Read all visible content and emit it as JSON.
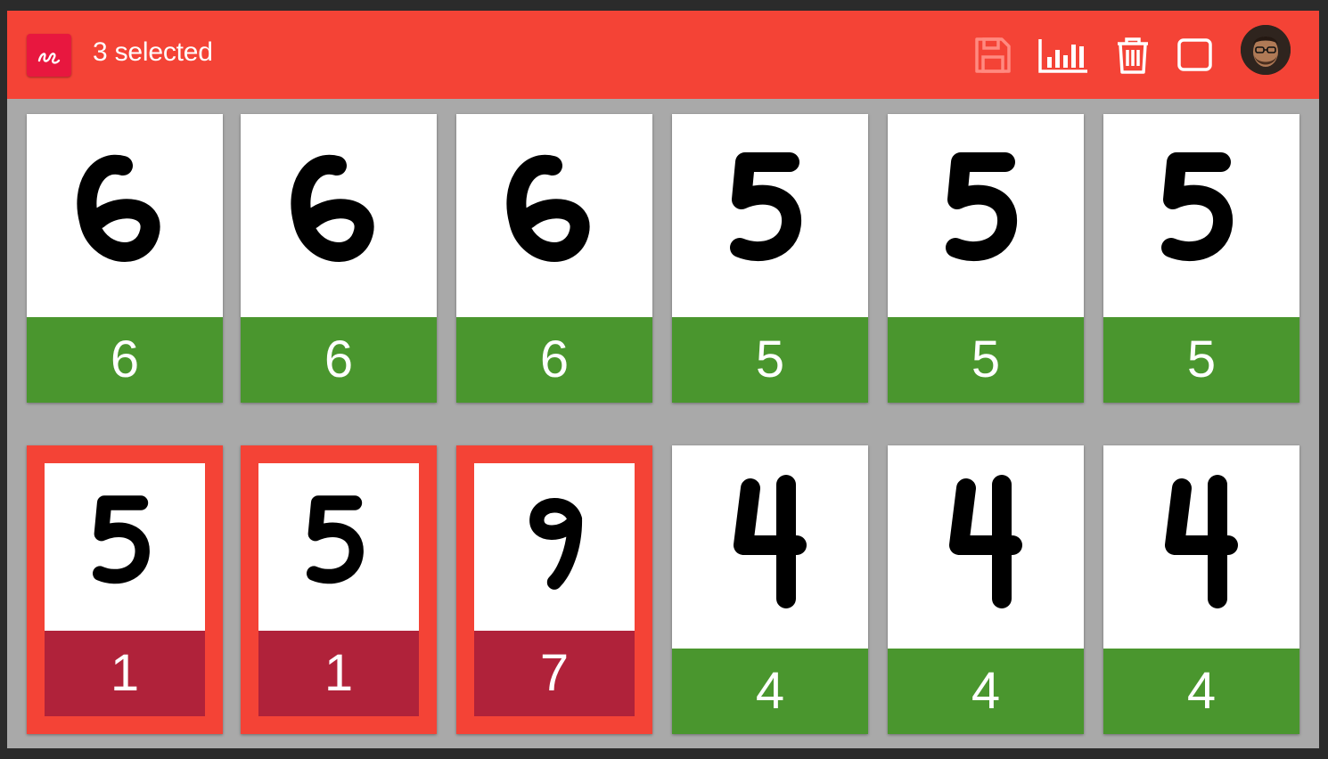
{
  "header": {
    "title": "3 selected",
    "colors": {
      "bar": "#f44336",
      "logo": "#e8173f"
    },
    "icons": [
      "save-icon",
      "bar-chart-icon",
      "trash-icon",
      "checkbox-icon"
    ]
  },
  "cards": [
    {
      "label": "6",
      "digit": "6",
      "selected": false
    },
    {
      "label": "6",
      "digit": "6",
      "selected": false
    },
    {
      "label": "6",
      "digit": "6",
      "selected": false
    },
    {
      "label": "5",
      "digit": "5",
      "selected": false
    },
    {
      "label": "5",
      "digit": "5",
      "selected": false
    },
    {
      "label": "5",
      "digit": "5",
      "selected": false
    },
    {
      "label": "1",
      "digit": "5",
      "selected": true
    },
    {
      "label": "1",
      "digit": "5",
      "selected": true
    },
    {
      "label": "7",
      "digit": "9",
      "selected": true
    },
    {
      "label": "4",
      "digit": "4",
      "selected": false
    },
    {
      "label": "4",
      "digit": "4",
      "selected": false
    },
    {
      "label": "4",
      "digit": "4",
      "selected": false
    }
  ],
  "label_colors": {
    "correct": "#4a962e",
    "wrong": "#b0223a"
  }
}
